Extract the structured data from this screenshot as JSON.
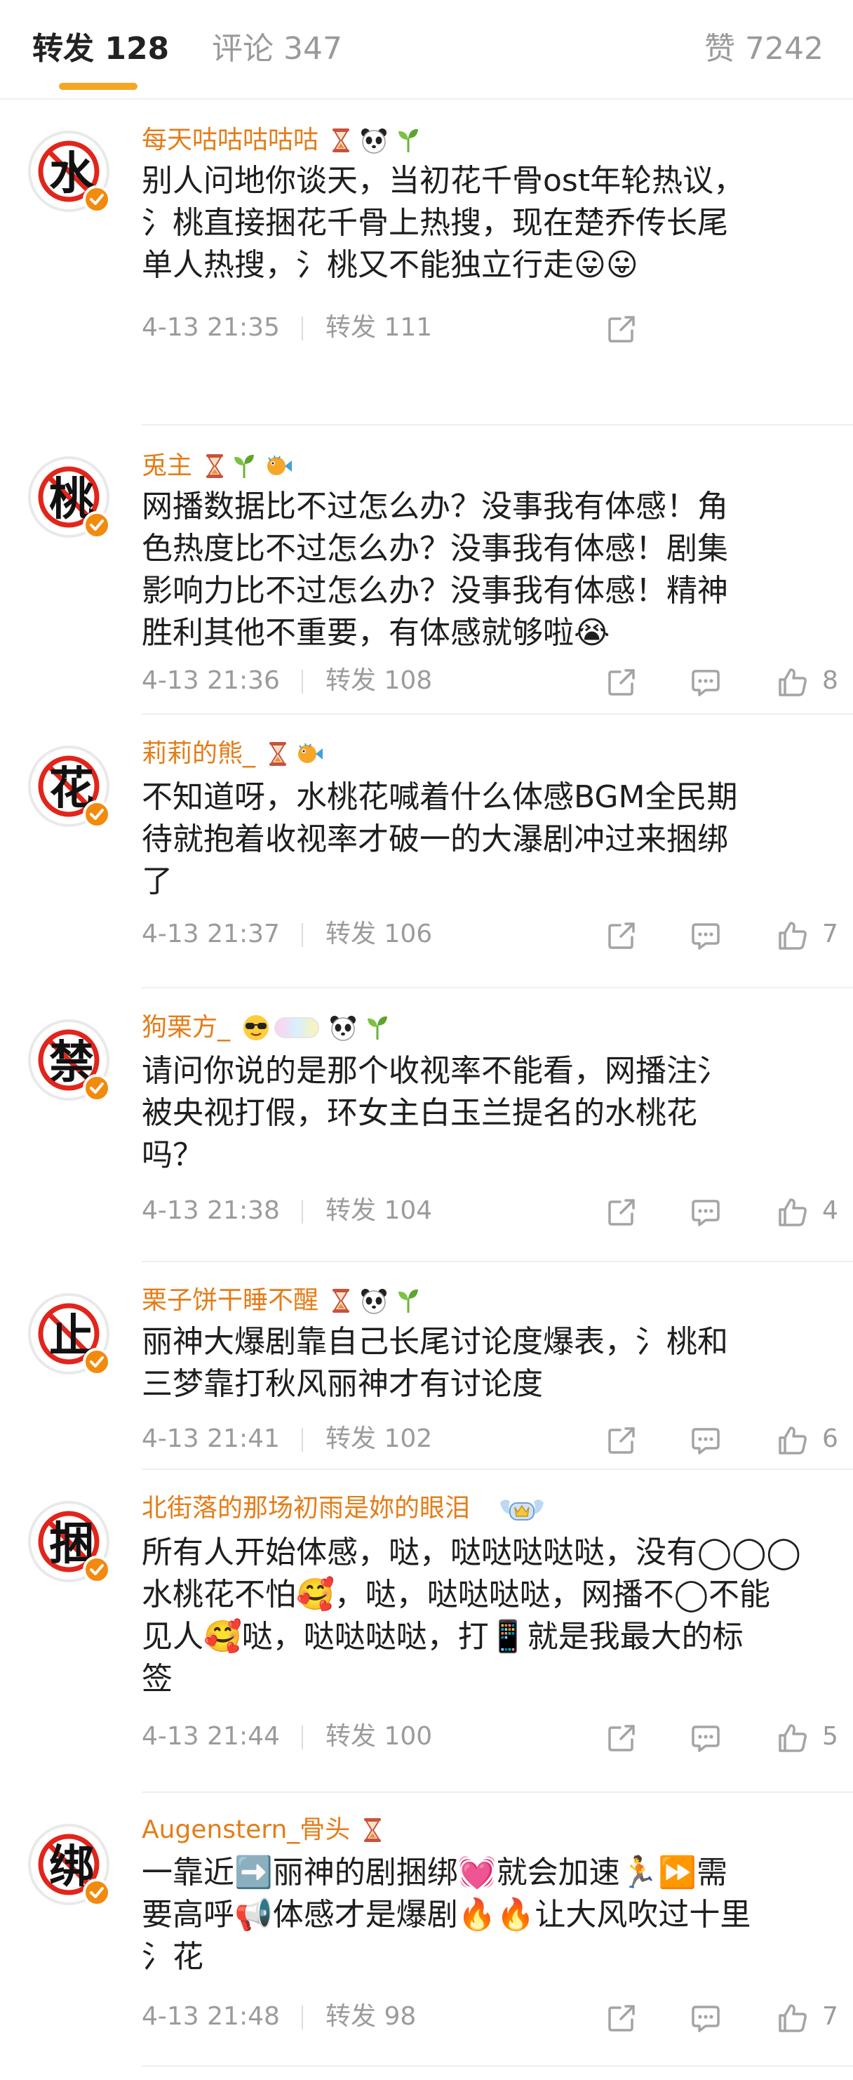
{
  "tabs": {
    "repost": {
      "label": "转发",
      "count": "128"
    },
    "comment": {
      "label": "评论",
      "count": "347"
    },
    "like": {
      "label": "赞",
      "count": "7242"
    }
  },
  "repost_label": "转发",
  "comments": [
    {
      "avatar_char": "水",
      "username": "每天咕咕咕咕咕",
      "badges": [
        "hourglass",
        "panda",
        "sprout"
      ],
      "content": "别人问地你谈天，当初花千骨ost年轮热议，\n氵桃直接捆花千骨上热搜，现在楚乔传长尾\n单人热搜，氵桃又不能独立行走😛😛",
      "time": "4-13 21:35",
      "reposts": "111",
      "likes": ""
    },
    {
      "avatar_char": "桃",
      "username": "兎主",
      "badges": [
        "hourglass",
        "sprout",
        "fish"
      ],
      "content": "网播数据比不过怎么办？没事我有体感！角\n色热度比不过怎么办？没事我有体感！剧集\n影响力比不过怎么办？没事我有体感！精神\n胜利其他不重要，有体感就够啦😭",
      "time": "4-13 21:36",
      "reposts": "108",
      "likes": "8"
    },
    {
      "avatar_char": "花",
      "username": "莉莉的熊_",
      "badges": [
        "hourglass",
        "fish"
      ],
      "content": "不知道呀，水桃花喊着什么体感BGM全民期\n待就抱着收视率才破一的大瀑剧冲过来捆绑\n了",
      "time": "4-13 21:37",
      "reposts": "106",
      "likes": "7"
    },
    {
      "avatar_char": "禁",
      "username": "狗栗方_",
      "badges": [
        "shades",
        "rainbow",
        "panda",
        "sprout"
      ],
      "content": "请问你说的是那个收视率不能看，网播注氵\n被央视打假，环女主白玉兰提名的水桃花\n吗？",
      "time": "4-13 21:38",
      "reposts": "104",
      "likes": "4"
    },
    {
      "avatar_char": "止",
      "username": "栗子饼干睡不醒",
      "badges": [
        "hourglass",
        "panda",
        "sprout"
      ],
      "content": "丽神大爆剧靠自己长尾讨论度爆表，氵桃和\n三梦靠打秋风丽神才有讨论度",
      "time": "4-13 21:41",
      "reposts": "102",
      "likes": "6"
    },
    {
      "avatar_char": "捆",
      "username": "北街落的那场初雨是妳的眼泪",
      "badges": [
        "crown"
      ],
      "content": "所有人开始体感，哒，哒哒哒哒哒，没有◯◯◯\n水桃花不怕🥰，哒，哒哒哒哒，网播不◯不能\n见人🥰哒，哒哒哒哒，打📱就是我最大的标\n签",
      "time": "4-13 21:44",
      "reposts": "100",
      "likes": "5"
    },
    {
      "avatar_char": "绑",
      "username": "Augenstern_骨头",
      "badges": [
        "hourglass"
      ],
      "content": "一靠近➡️丽神的剧捆绑💓就会加速🏃⏩需\n要高呼📢体感才是爆剧🔥🔥让大风吹过十里\n氵花",
      "time": "4-13 21:48",
      "reposts": "98",
      "likes": "7"
    }
  ],
  "colors": {
    "accent": "#f5a623",
    "username": "#e37d18",
    "meta": "#9b9b9b",
    "verified": "#f28a0e"
  }
}
